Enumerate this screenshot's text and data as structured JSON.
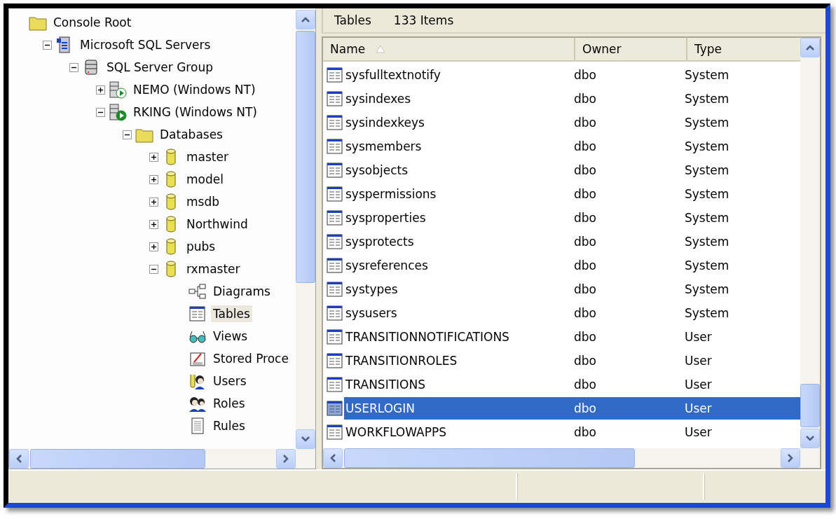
{
  "tree": [
    {
      "label": "Console Root",
      "kind": "folder",
      "selected": false,
      "children": [
        {
          "label": "Microsoft SQL Servers",
          "kind": "servers",
          "expanded": true,
          "selected": false,
          "children": [
            {
              "label": "SQL Server Group",
              "kind": "group",
              "expanded": true,
              "selected": false,
              "children": [
                {
                  "label": "NEMO (Windows NT)",
                  "kind": "server_idle",
                  "expanded": false,
                  "selected": false
                },
                {
                  "label": "RKING (Windows NT)",
                  "kind": "server_running",
                  "expanded": true,
                  "selected": false,
                  "children": [
                    {
                      "label": "Databases",
                      "kind": "folder",
                      "expanded": true,
                      "selected": false,
                      "children": [
                        {
                          "label": "master",
                          "kind": "database",
                          "expanded": false,
                          "selected": false
                        },
                        {
                          "label": "model",
                          "kind": "database",
                          "expanded": false,
                          "selected": false
                        },
                        {
                          "label": "msdb",
                          "kind": "database",
                          "expanded": false,
                          "selected": false
                        },
                        {
                          "label": "Northwind",
                          "kind": "database",
                          "expanded": false,
                          "selected": false
                        },
                        {
                          "label": "pubs",
                          "kind": "database",
                          "expanded": false,
                          "selected": false
                        },
                        {
                          "label": "rxmaster",
                          "kind": "database",
                          "expanded": true,
                          "selected": false,
                          "children": [
                            {
                              "label": "Diagrams",
                              "kind": "diagram",
                              "selected": false
                            },
                            {
                              "label": "Tables",
                              "kind": "table",
                              "selected": true
                            },
                            {
                              "label": "Views",
                              "kind": "views",
                              "selected": false
                            },
                            {
                              "label": "Stored Proce",
                              "kind": "procedure",
                              "selected": false
                            },
                            {
                              "label": "Users",
                              "kind": "users",
                              "selected": false
                            },
                            {
                              "label": "Roles",
                              "kind": "roles",
                              "selected": false
                            },
                            {
                              "label": "Rules",
                              "kind": "rules",
                              "selected": false
                            }
                          ]
                        }
                      ]
                    }
                  ]
                }
              ]
            }
          ]
        }
      ]
    }
  ],
  "list_header": {
    "title": "Tables",
    "count": "133 Items"
  },
  "table": {
    "columns": [
      "Name",
      "Owner",
      "Type"
    ],
    "rows": [
      {
        "name": "sysfulltextnotify",
        "owner": "dbo",
        "type": "System",
        "selected": false
      },
      {
        "name": "sysindexes",
        "owner": "dbo",
        "type": "System",
        "selected": false
      },
      {
        "name": "sysindexkeys",
        "owner": "dbo",
        "type": "System",
        "selected": false
      },
      {
        "name": "sysmembers",
        "owner": "dbo",
        "type": "System",
        "selected": false
      },
      {
        "name": "sysobjects",
        "owner": "dbo",
        "type": "System",
        "selected": false
      },
      {
        "name": "syspermissions",
        "owner": "dbo",
        "type": "System",
        "selected": false
      },
      {
        "name": "sysproperties",
        "owner": "dbo",
        "type": "System",
        "selected": false
      },
      {
        "name": "sysprotects",
        "owner": "dbo",
        "type": "System",
        "selected": false
      },
      {
        "name": "sysreferences",
        "owner": "dbo",
        "type": "System",
        "selected": false
      },
      {
        "name": "systypes",
        "owner": "dbo",
        "type": "System",
        "selected": false
      },
      {
        "name": "sysusers",
        "owner": "dbo",
        "type": "System",
        "selected": false
      },
      {
        "name": "TRANSITIONNOTIFICATIONS",
        "owner": "dbo",
        "type": "User",
        "selected": false
      },
      {
        "name": "TRANSITIONROLES",
        "owner": "dbo",
        "type": "User",
        "selected": false
      },
      {
        "name": "TRANSITIONS",
        "owner": "dbo",
        "type": "User",
        "selected": false
      },
      {
        "name": "USERLOGIN",
        "owner": "dbo",
        "type": "User",
        "selected": true
      },
      {
        "name": "WORKFLOWAPPS",
        "owner": "dbo",
        "type": "User",
        "selected": false
      }
    ]
  }
}
